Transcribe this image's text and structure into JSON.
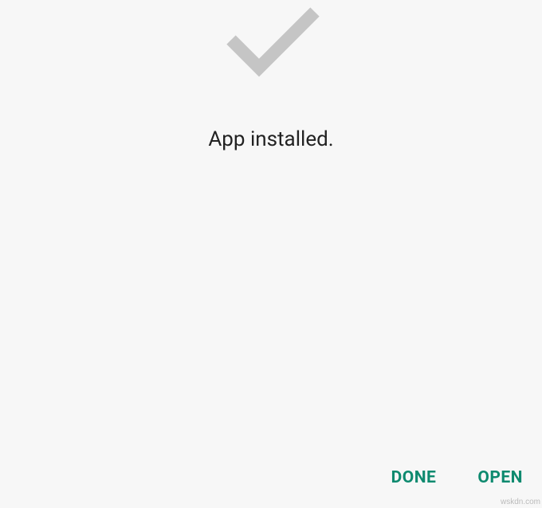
{
  "status": {
    "message": "App installed."
  },
  "buttons": {
    "done": "DONE",
    "open": "OPEN"
  },
  "watermark": "wskdn.com",
  "colors": {
    "accent": "#0e8a6f",
    "checkmark": "#c5c5c5",
    "background": "#f7f7f7"
  }
}
